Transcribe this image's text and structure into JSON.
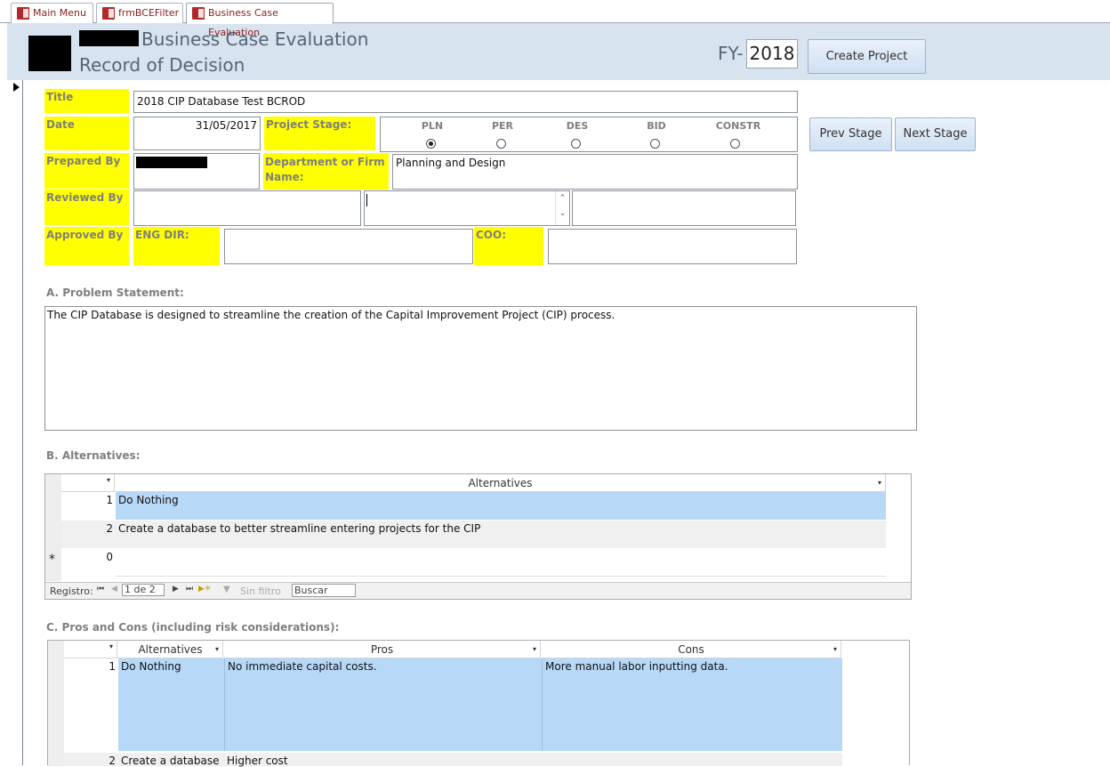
{
  "tabs": [
    {
      "label": "Main Menu"
    },
    {
      "label": "frmBCEFilter"
    },
    {
      "label": "Business Case Evaluation"
    }
  ],
  "header": {
    "title_line1": "Business Case Evaluation",
    "title_line2": "Record of Decision",
    "fy_label": "FY-",
    "fy_value": "2018",
    "create_project_label": "Create Project"
  },
  "form": {
    "title_label": "Title",
    "title_value": "2018 CIP Database Test BCROD",
    "date_label": "Date",
    "date_value": "31/05/2017",
    "project_stage_label": "Project Stage:",
    "stages": [
      "PLN",
      "PER",
      "DES",
      "BID",
      "CONSTR"
    ],
    "selected_stage": "PLN",
    "prev_stage_label": "Prev Stage",
    "next_stage_label": "Next Stage",
    "prepared_by_label": "Prepared By",
    "department_label": "Department or Firm Name:",
    "department_value": "Planning and Design",
    "reviewed_by_label": "Reviewed By",
    "approved_by_label": "Approved By",
    "eng_dir_label": "ENG DIR:",
    "coo_label": "COO:"
  },
  "problem": {
    "heading": "A. Problem Statement:",
    "text": "The CIP Database is designed to streamline the creation of the Capital Improvement Project (CIP) process."
  },
  "alternatives": {
    "heading": "B. Alternatives:",
    "column": "Alternatives",
    "rows": [
      {
        "num": "1",
        "text": "Do Nothing"
      },
      {
        "num": "2",
        "text": "Create a database to better streamline entering projects for the CIP"
      },
      {
        "num": "0",
        "text": ""
      }
    ],
    "new_row_marker": "*",
    "nav": {
      "record_label": "Registro:",
      "position": "1 de 2",
      "filter_label": "Sin filtro",
      "search_value": "Buscar"
    }
  },
  "pros_cons": {
    "heading": "C. Pros and Cons (including risk considerations):",
    "columns": [
      "Alternatives",
      "Pros",
      "Cons"
    ],
    "rows": [
      {
        "num": "1",
        "alternative": "Do Nothing",
        "pros": "No immediate capital costs.",
        "cons": "More manual labor inputting data."
      },
      {
        "num": "2",
        "alternative": "Create a database",
        "pros": "Higher cost",
        "cons": ""
      }
    ]
  },
  "colors": {
    "label_yellow": "#ffff00",
    "header_bg": "#d7e3ee",
    "selected_row": "#b8d8f8",
    "tab_text": "#8b1d1d"
  }
}
